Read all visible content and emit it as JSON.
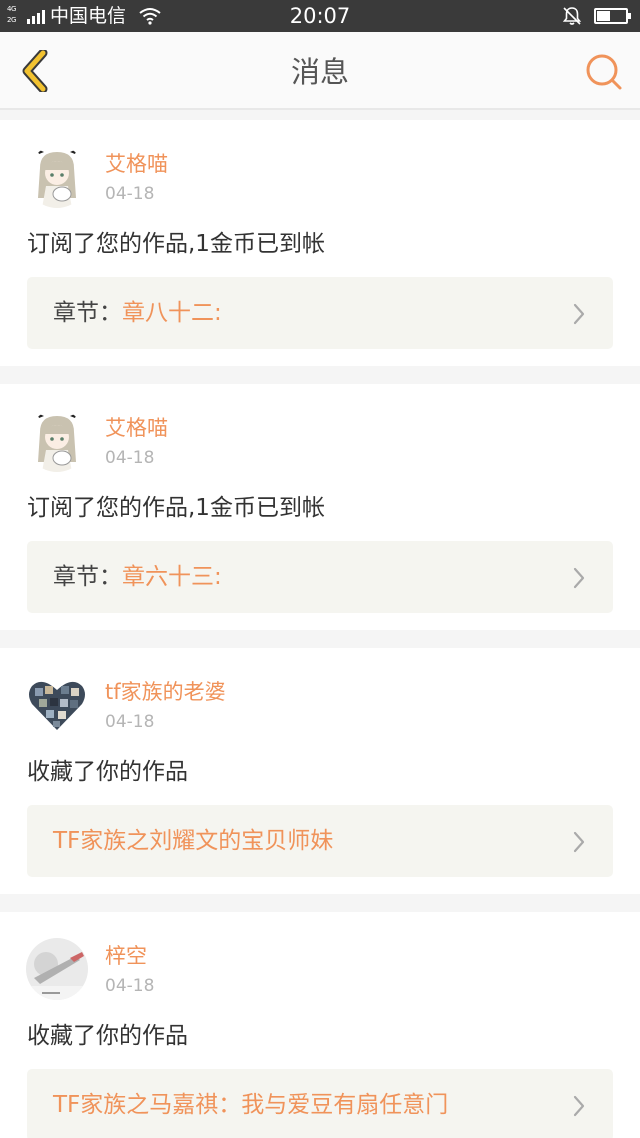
{
  "status_bar": {
    "network_top": "4G",
    "network_bottom": "2G",
    "carrier": "中国电信",
    "time": "20:07",
    "battery_level": 0.45,
    "background_color": "#3a3a3a"
  },
  "nav": {
    "title": "消息",
    "back_icon": "chevron-left-icon",
    "search_icon": "search-icon",
    "back_color": "#f2c230",
    "search_color": "#f0935a"
  },
  "accent_color": "#f0935a",
  "messages": [
    {
      "user": "艾格喵",
      "date": "04-18",
      "action": "订阅了您的作品,1金币已到帐",
      "work_label": "章节：",
      "work_title": "章八十二:"
    },
    {
      "user": "艾格喵",
      "date": "04-18",
      "action": "订阅了您的作品,1金币已到帐",
      "work_label": "章节：",
      "work_title": "章六十三:"
    },
    {
      "user": "tf家族的老婆",
      "date": "04-18",
      "action": "收藏了你的作品",
      "work_label": "",
      "work_title": "TF家族之刘耀文的宝贝师妹"
    },
    {
      "user": "梓空",
      "date": "04-18",
      "action": "收藏了你的作品",
      "work_label": "",
      "work_title": "TF家族之马嘉祺：我与爱豆有扇任意门"
    }
  ]
}
